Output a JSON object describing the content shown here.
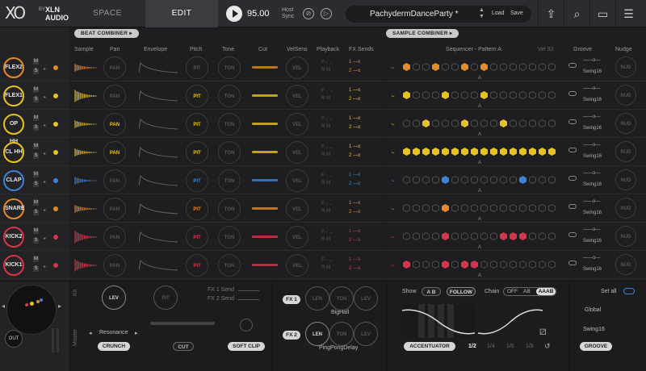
{
  "header": {
    "logo_xo": "XO",
    "logo_by": "BY",
    "logo_xln": "XLN",
    "logo_audio": "AUDIO",
    "tab_space": "SPACE",
    "tab_edit": "EDIT",
    "tempo": "95.00",
    "host_sync_1": "Host",
    "host_sync_2": "Sync",
    "preset_name": "PachydermDanceParty *",
    "load": "Load",
    "save": "Save"
  },
  "sections": {
    "beat_combiner": "BEAT COMBINER",
    "sample_combiner": "SAMPLE COMBINER"
  },
  "columns": {
    "sample": "Sample",
    "pan": "Pan",
    "envelope": "Envelope",
    "pitch": "Pitch",
    "tone": "Tone",
    "cut": "Cut",
    "velsens": "VelSens",
    "playback": "Playback",
    "fxsends": "FX Sends",
    "sequencer": "Sequencer - Pattern A",
    "vel": "Vel",
    "vel_value": "92",
    "groove": "Groove",
    "nudge": "Nudge"
  },
  "knob_labels": {
    "pan": "PAN",
    "pit": "PIT",
    "ton": "TON",
    "vel": "VEL",
    "nud": "NUD"
  },
  "tracks": [
    {
      "name": "FLEX2",
      "color": "#e58a2a",
      "swing": "Swing16",
      "steps": [
        1,
        0,
        0,
        1,
        0,
        0,
        1,
        0,
        1,
        0,
        0,
        0,
        0,
        0,
        0,
        0
      ]
    },
    {
      "name": "FLEX1",
      "color": "#e8c21e",
      "swing": "Swing16",
      "steps": [
        1,
        0,
        0,
        0,
        1,
        0,
        0,
        0,
        1,
        0,
        0,
        0,
        0,
        0,
        0,
        0
      ]
    },
    {
      "name": "OP HH",
      "color": "#e8c21e",
      "swing": "Swing16",
      "steps": [
        0,
        0,
        1,
        0,
        0,
        0,
        1,
        0,
        0,
        0,
        1,
        0,
        0,
        0,
        0,
        0
      ]
    },
    {
      "name": "CL HH",
      "color": "#e8c21e",
      "swing": "Swing16",
      "steps": [
        1,
        1,
        1,
        1,
        1,
        1,
        1,
        1,
        1,
        1,
        1,
        1,
        1,
        1,
        1,
        1
      ]
    },
    {
      "name": "CLAP",
      "color": "#3d82d6",
      "swing": "Swing16",
      "steps": [
        0,
        0,
        0,
        0,
        1,
        0,
        0,
        0,
        0,
        0,
        0,
        0,
        1,
        0,
        0,
        0
      ]
    },
    {
      "name": "SNARE",
      "color": "#e58a2a",
      "swing": "Swing16",
      "steps": [
        0,
        0,
        0,
        0,
        1,
        0,
        0,
        0,
        0,
        0,
        0,
        0,
        0,
        0,
        0,
        0
      ]
    },
    {
      "name": "KICK2",
      "color": "#d6344a",
      "swing": "Swing16",
      "steps": [
        0,
        0,
        0,
        0,
        1,
        0,
        0,
        0,
        0,
        0,
        1,
        1,
        1,
        0,
        0,
        0
      ]
    },
    {
      "name": "KICK1",
      "color": "#d6344a",
      "swing": "Swing16",
      "steps": [
        1,
        0,
        0,
        0,
        1,
        0,
        1,
        1,
        0,
        0,
        0,
        0,
        0,
        0,
        0,
        0
      ]
    }
  ],
  "pattern_letter": "A",
  "playback": {
    "f": "F",
    "r": "R",
    "m": "M"
  },
  "fx": {
    "one": "1",
    "two": "2"
  },
  "bottom": {
    "out": "OUT",
    "kit": "Kit",
    "master": "Master",
    "lev": "LEV",
    "pit": "PIT",
    "fx1send": "FX 1 Send",
    "fx2send": "FX 2 Send",
    "resonance": "Resonance",
    "crunch": "CRUNCH",
    "cut": "CUT",
    "softclip": "SOFT CLIP",
    "fx1": "FX 1",
    "fx2": "FX 2",
    "len": "LEN",
    "ton": "TON",
    "lev2": "LEV",
    "bighall": "BigHall",
    "pingpong": "PingPongDelay",
    "show": "Show",
    "a": "A",
    "b": "B",
    "follow": "FOLLOW",
    "chain": "Chain",
    "off": "OFF",
    "ab": "AB",
    "aaab": "AAAB",
    "accentuator": "ACCENTUATOR",
    "half": "1/2",
    "quarter": "1/4",
    "sixth": "1/6",
    "eighth": "1/8",
    "setall": "Set all",
    "global": "Global",
    "swing_global": "Swing16",
    "groove": "GROOVE"
  }
}
